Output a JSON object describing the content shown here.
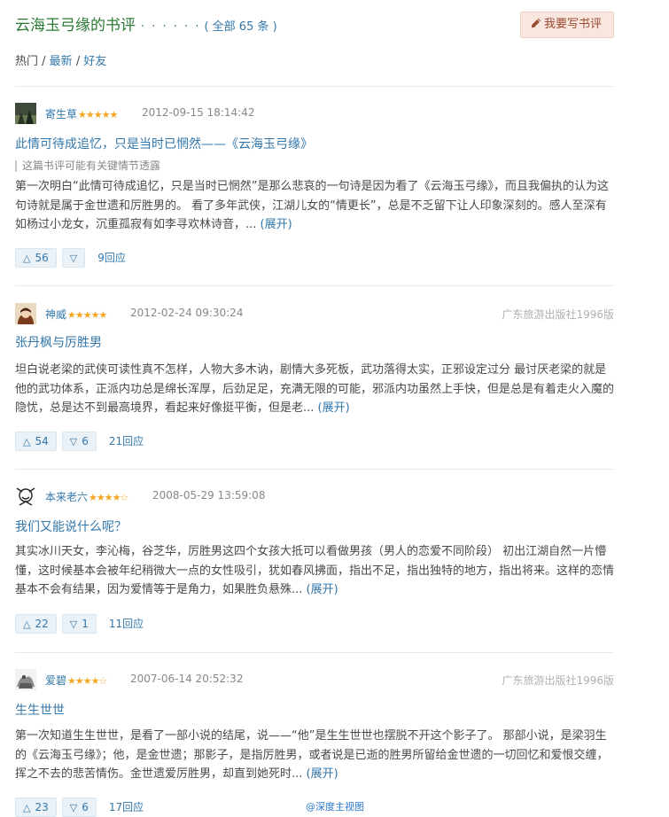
{
  "header": {
    "title": "云海玉弓缘的书评",
    "dots": "· · · · · ·",
    "count": "( 全部 65 条 )",
    "write_button": "我要写书评"
  },
  "filters": {
    "current": "热门",
    "sep1": " / ",
    "latest": "最新",
    "sep2": " / ",
    "friends": "好友"
  },
  "reviews": [
    {
      "author": "寄生草",
      "stars": "★★★★★",
      "rating": 5,
      "date": "2012-09-15 18:14:42",
      "edition": "",
      "title": "此情可待成追忆，只是当时已惘然——《云海玉弓缘》",
      "spoiler": "这篇书评可能有关键情节透露",
      "body": "第一次明白“此情可待成追忆，只是当时已惘然”是那么悲哀的一句诗是因为看了《云海玉弓缘》，而且我偏执的认为这句诗就是属于金世遗和厉胜男的。 看了多年武侠，江湖儿女的“情更长”，总是不乏留下让人印象深刻的。感人至深有如杨过小龙女，沉重孤寂有如李寻欢林诗音，... ",
      "expand": "(展开)",
      "up": "56",
      "down": "",
      "replies": "9回应"
    },
    {
      "author": "神威",
      "stars": "★★★★★",
      "rating": 5,
      "date": "2012-02-24 09:30:24",
      "edition": "广东旅游出版社1996版",
      "title": "张丹枫与厉胜男",
      "spoiler": "",
      "body": "坦白说老梁的武侠可读性真不怎样，人物大多木讷，剧情大多死板，武功落得太实，正邪设定过分 最讨厌老梁的就是他的武功体系，正派内功总是绵长浑厚，后劲足足，充满无限的可能，邪派内功虽然上手快，但是总是有着走火入魔的隐忧，总是达不到最高境界，看起来好像挺平衡，但是老... ",
      "expand": "(展开)",
      "up": "54",
      "down": "6",
      "replies": "21回应"
    },
    {
      "author": "本来老六",
      "stars": "★★★★☆",
      "rating": 4,
      "date": "2008-05-29 13:59:08",
      "edition": "",
      "title": "我们又能说什么呢？",
      "spoiler": "",
      "body": "其实冰川天女，李沁梅，谷芝华，厉胜男这四个女孩大抵可以看做男孩（男人的恋爱不同阶段） 初出江湖自然一片懵懂，这时候基本会被年纪稍微大一点的女性吸引，犹如春风拂面，指出不足，指出独特的地方，指出将来。这样的恋情基本不会有结果，因为爱情等于是角力，如果胜负悬殊... ",
      "expand": "(展开)",
      "up": "22",
      "down": "1",
      "replies": "11回应"
    },
    {
      "author": "爱碧",
      "stars": "★★★★☆",
      "rating": 4,
      "date": "2007-06-14 20:52:32",
      "edition": "广东旅游出版社1996版",
      "title": "生生世世",
      "spoiler": "",
      "body": "第一次知道生生世世，是看了一部小说的结尾，说——“他”是生生世世也摆脱不开这个影子了。 那部小说，是梁羽生的《云海玉弓缘》；他，是金世遗；那影子，是指厉胜男，或者说是已逝的胜男所留给金世遗的一切回忆和爱恨交缠，挥之不去的悲苦情伤。金世遗爱厉胜男，却直到她死时... ",
      "expand": "(展开)",
      "up": "23",
      "down": "6",
      "replies": "17回应"
    }
  ],
  "watermark": "@深度主视图",
  "colors": {
    "link": "#3377aa",
    "title_green": "#2a7a34",
    "star": "#f5a623"
  }
}
